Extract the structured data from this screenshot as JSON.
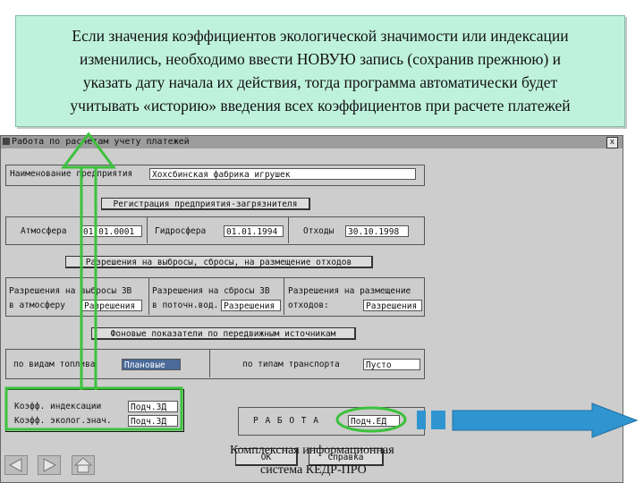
{
  "note": {
    "lines": [
      "Если  значения коэффициентов экологической значимости или  индексации",
      "изменились, необходимо ввести НОВУЮ запись (сохранив прежнюю)  и",
      "указать дату начала  их  действия, тогда программа  автоматически будет",
      "учитывать «историю» введения всех коэффициентов  при  расчете платежей"
    ]
  },
  "window": {
    "title": "Работа по расчетам учету платежей",
    "close_label": "x"
  },
  "enterprise": {
    "label": "Наименование предприятия",
    "value": "Хохсбинская фабрика игрушек"
  },
  "registration_button": "Регистрация предприятия-загрязнителя",
  "dates": {
    "atmosphere_label": "Атмосфера",
    "atmosphere_value": "01.01.0001",
    "hydrosphere_label": "Гидросфера",
    "hydrosphere_value": "01.01.1994",
    "waste_label": "Отходы",
    "waste_value": "30.10.1998"
  },
  "permits_button": "Разрешения на выбросы, сбросы, на размещение отходов",
  "permits": {
    "col1_line1": "Разрешения на выбросы ЗВ",
    "col1_line2": "в атмосферу",
    "col1_value": "Разрешения",
    "col2_line1": "Разрешения на сбросы ЗВ",
    "col2_line2": "в поточн.вод.",
    "col2_value": "Разрешения",
    "col3_line1": "Разрешения на размещение",
    "col3_line2": "отходов:",
    "col3_value": "Разрешения"
  },
  "background_button": "Фоновые показатели по передвижным источникам",
  "mobile": {
    "fuel_label": "по видам топлива",
    "fuel_value": "Плановые",
    "transport_label": "по типам транспорта",
    "transport_value": "Пусто"
  },
  "coefficients": {
    "index_label": "Коэфф. индексации",
    "index_value": "Подч.ЗД",
    "ecology_label": "Коэфф. эколог.знач.",
    "ecology_value": "Подч.ЗД"
  },
  "work": {
    "label": "Р А Б О Т А",
    "value": "Подч.ЕД"
  },
  "bottom_buttons": {
    "ok": "ОК",
    "help": "Справка"
  },
  "brand": {
    "line1": "Комплексная информационная",
    "line2": "система КЕДР-ПРО"
  },
  "colors": {
    "note_bg": "#bff2de",
    "highlight_green": "#3cc13c",
    "arrow_blue": "#2f95d0",
    "window_bg": "#cdcdcd"
  },
  "icons": {
    "nav_prev": "triangle-left-icon",
    "nav_next": "triangle-right-icon",
    "nav_home": "home-icon"
  }
}
